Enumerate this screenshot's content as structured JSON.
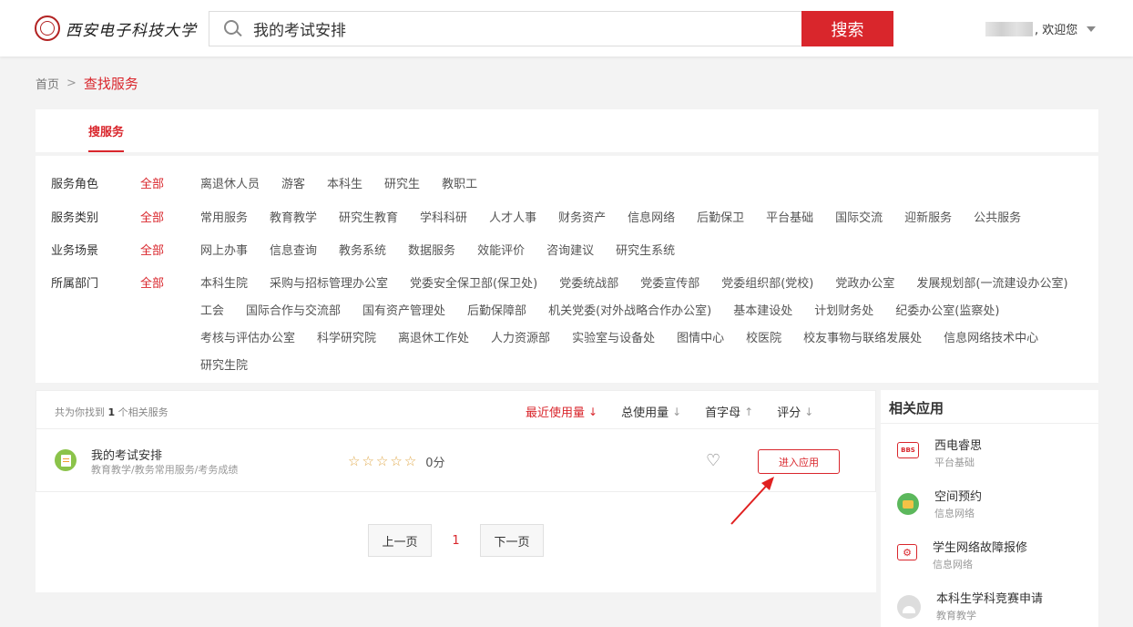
{
  "header": {
    "logo_text": "西安电子科技大学",
    "search_value": "我的考试安排",
    "search_button": "搜索",
    "user_greeting": ", 欢迎您"
  },
  "breadcrumb": {
    "home": "首页",
    "separator": ">",
    "current": "查找服务"
  },
  "tab": {
    "label": "搜服务"
  },
  "filters": {
    "all_label": "全部",
    "rows": [
      {
        "label": "服务角色",
        "items": [
          "离退休人员",
          "游客",
          "本科生",
          "研究生",
          "教职工"
        ]
      },
      {
        "label": "服务类别",
        "items": [
          "常用服务",
          "教育教学",
          "研究生教育",
          "学科科研",
          "人才人事",
          "财务资产",
          "信息网络",
          "后勤保卫",
          "平台基础",
          "国际交流",
          "迎新服务",
          "公共服务"
        ]
      },
      {
        "label": "业务场景",
        "items": [
          "网上办事",
          "信息查询",
          "教务系统",
          "数据服务",
          "效能评价",
          "咨询建议",
          "研究生系统"
        ]
      },
      {
        "label": "所属部门",
        "items": [
          "本科生院",
          "采购与招标管理办公室",
          "党委安全保卫部(保卫处)",
          "党委统战部",
          "党委宣传部",
          "党委组织部(党校)",
          "党政办公室",
          "发展规划部(一流建设办公室)",
          "工会",
          "国际合作与交流部",
          "国有资产管理处",
          "后勤保障部",
          "机关党委(对外战略合作办公室)",
          "基本建设处",
          "计划财务处",
          "纪委办公室(监察处)",
          "考核与评估办公室",
          "科学研究院",
          "离退休工作处",
          "人力资源部",
          "实验室与设备处",
          "图情中心",
          "校医院",
          "校友事物与联络发展处",
          "信息网络技术中心",
          "研究生院"
        ]
      }
    ]
  },
  "results": {
    "count_prefix": "共为你找到",
    "count": "1",
    "count_suffix": "个相关服务",
    "sorts": [
      {
        "label": "最近使用量",
        "arrow": "down",
        "active": true
      },
      {
        "label": "总使用量",
        "arrow": "down",
        "active": false
      },
      {
        "label": "首字母",
        "arrow": "up",
        "active": false
      },
      {
        "label": "评分",
        "arrow": "down",
        "active": false
      }
    ],
    "items": [
      {
        "name": "我的考试安排",
        "path": "教育教学/教务常用服务/考务成绩",
        "rating": 0,
        "score": "0分",
        "enter": "进入应用"
      }
    ]
  },
  "pager": {
    "prev": "上一页",
    "current": "1",
    "next": "下一页"
  },
  "related": {
    "title": "相关应用",
    "items": [
      {
        "name": "西电睿思",
        "category": "平台基础",
        "icon": "bbs-icon",
        "icon_text": "BBS"
      },
      {
        "name": "空间预约",
        "category": "信息网络",
        "icon": "space-booking-icon"
      },
      {
        "name": "学生网络故障报修",
        "category": "信息网络",
        "icon": "repair-icon"
      },
      {
        "name": "本科生学科竞赛申请",
        "category": "教育教学",
        "icon": "competition-icon"
      }
    ]
  },
  "colors": {
    "accent": "#d9262c",
    "background": "#f3f3f3"
  }
}
